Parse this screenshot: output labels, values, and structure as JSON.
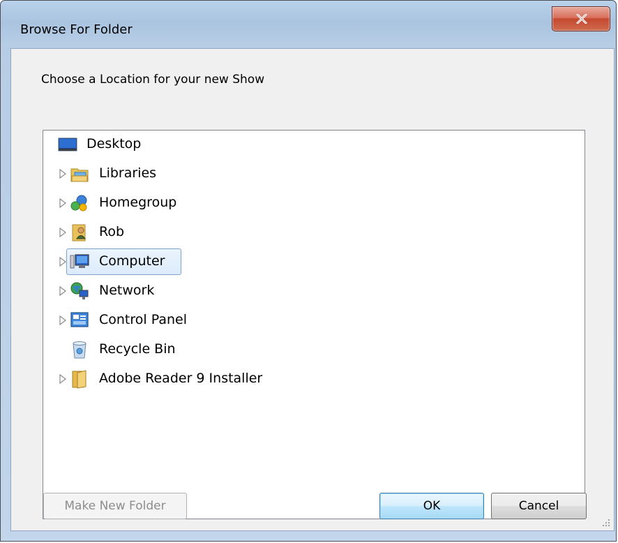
{
  "window": {
    "title": "Browse For Folder",
    "close_glyph": "x",
    "close_icon": "close-icon"
  },
  "dialog": {
    "prompt": "Choose a Location for your new Show"
  },
  "tree": {
    "items": [
      {
        "label": "Desktop",
        "icon": "desktop-icon",
        "expandable": false,
        "selected": false
      },
      {
        "label": "Libraries",
        "icon": "libraries-icon",
        "expandable": true,
        "selected": false
      },
      {
        "label": "Homegroup",
        "icon": "homegroup-icon",
        "expandable": true,
        "selected": false
      },
      {
        "label": "Rob",
        "icon": "user-folder-icon",
        "expandable": true,
        "selected": false
      },
      {
        "label": "Computer",
        "icon": "computer-icon",
        "expandable": true,
        "selected": true
      },
      {
        "label": "Network",
        "icon": "network-icon",
        "expandable": true,
        "selected": false
      },
      {
        "label": "Control Panel",
        "icon": "control-panel-icon",
        "expandable": true,
        "selected": false
      },
      {
        "label": "Recycle Bin",
        "icon": "recycle-bin-icon",
        "expandable": false,
        "selected": false
      },
      {
        "label": "Adobe Reader 9 Installer",
        "icon": "folder-icon",
        "expandable": true,
        "selected": false
      }
    ]
  },
  "buttons": {
    "make_new_folder": "Make New Folder",
    "ok": "OK",
    "cancel": "Cancel"
  },
  "colors": {
    "selection_border": "#7da2ce",
    "selection_fill": "#dcebfc",
    "close_red": "#c44a30",
    "frame_blue": "#b9d1ea"
  }
}
